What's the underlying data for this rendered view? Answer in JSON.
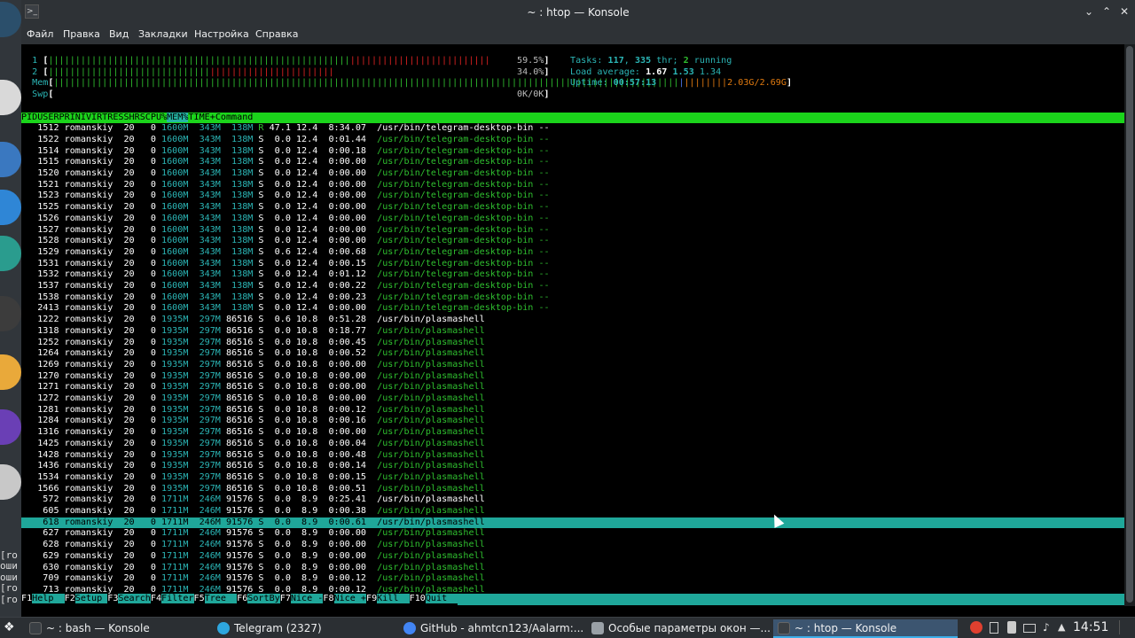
{
  "window": {
    "title": "~ : htop — Konsole"
  },
  "menu": [
    "Файл",
    "Правка",
    "Вид",
    "Закладки",
    "Настройка",
    "Справка"
  ],
  "meters": {
    "cpu1_label": "1",
    "cpu1_green": "||||||||||||||||||||||||||||||||||||||||||||||||||||||||",
    "cpu1_red": "||||||||||||||||||||||||||",
    "cpu1_value": "59.5%",
    "cpu2_label": "2",
    "cpu2_green": "||||||||||||||||||||||||||||||",
    "cpu2_red": "|||||||||||||||||||||||",
    "cpu2_value": "34.0%",
    "mem_label": "Mem",
    "mem_green": "||||||||||||||||||||||||||||||||||||||||||||||||||||||||||||||||||||||||||||||||||||||||||||||||||||||||||||||||||||",
    "mem_blue": "|",
    "mem_yellow": "||||||||",
    "mem_value": "2.03G/2.69G",
    "swp_label": "Swp",
    "swp_value": "0K/0K",
    "tasks_label": "Tasks: ",
    "tasks_count": "117",
    "thr_sep": ", ",
    "thr_count": "335",
    "thr_label": " thr; ",
    "running_count": "2",
    "running_label": " running",
    "load_label": "Load average: ",
    "load1": "1.67",
    "load5": "1.53",
    "load15": "1.34",
    "uptime_label": "Uptime: ",
    "uptime_value": "00:57:13"
  },
  "columns": [
    "PID",
    "USER",
    "PRI",
    "NI",
    "VIRT",
    "RES",
    "SHR",
    "S",
    "CPU%",
    "MEM%",
    "TIME+",
    "Command"
  ],
  "sort_column": "MEM%",
  "processes": [
    {
      "pid": "1512",
      "user": "romanskiy",
      "pri": "20",
      "ni": "0",
      "virt": "1600M",
      "res": "343M",
      "shr": "138M",
      "s": "R",
      "cpu": "47.1",
      "mem": "12.4",
      "time": "8:34.07",
      "cmd": "/usr/bin/telegram-desktop-bin --",
      "thread": false
    },
    {
      "pid": "1522",
      "user": "romanskiy",
      "pri": "20",
      "ni": "0",
      "virt": "1600M",
      "res": "343M",
      "shr": "138M",
      "s": "S",
      "cpu": "0.0",
      "mem": "12.4",
      "time": "0:01.44",
      "cmd": "/usr/bin/telegram-desktop-bin --",
      "thread": true
    },
    {
      "pid": "1514",
      "user": "romanskiy",
      "pri": "20",
      "ni": "0",
      "virt": "1600M",
      "res": "343M",
      "shr": "138M",
      "s": "S",
      "cpu": "0.0",
      "mem": "12.4",
      "time": "0:00.18",
      "cmd": "/usr/bin/telegram-desktop-bin --",
      "thread": true
    },
    {
      "pid": "1515",
      "user": "romanskiy",
      "pri": "20",
      "ni": "0",
      "virt": "1600M",
      "res": "343M",
      "shr": "138M",
      "s": "S",
      "cpu": "0.0",
      "mem": "12.4",
      "time": "0:00.00",
      "cmd": "/usr/bin/telegram-desktop-bin --",
      "thread": true
    },
    {
      "pid": "1520",
      "user": "romanskiy",
      "pri": "20",
      "ni": "0",
      "virt": "1600M",
      "res": "343M",
      "shr": "138M",
      "s": "S",
      "cpu": "0.0",
      "mem": "12.4",
      "time": "0:00.00",
      "cmd": "/usr/bin/telegram-desktop-bin --",
      "thread": true
    },
    {
      "pid": "1521",
      "user": "romanskiy",
      "pri": "20",
      "ni": "0",
      "virt": "1600M",
      "res": "343M",
      "shr": "138M",
      "s": "S",
      "cpu": "0.0",
      "mem": "12.4",
      "time": "0:00.00",
      "cmd": "/usr/bin/telegram-desktop-bin --",
      "thread": true
    },
    {
      "pid": "1523",
      "user": "romanskiy",
      "pri": "20",
      "ni": "0",
      "virt": "1600M",
      "res": "343M",
      "shr": "138M",
      "s": "S",
      "cpu": "0.0",
      "mem": "12.4",
      "time": "0:00.00",
      "cmd": "/usr/bin/telegram-desktop-bin --",
      "thread": true
    },
    {
      "pid": "1525",
      "user": "romanskiy",
      "pri": "20",
      "ni": "0",
      "virt": "1600M",
      "res": "343M",
      "shr": "138M",
      "s": "S",
      "cpu": "0.0",
      "mem": "12.4",
      "time": "0:00.00",
      "cmd": "/usr/bin/telegram-desktop-bin --",
      "thread": true
    },
    {
      "pid": "1526",
      "user": "romanskiy",
      "pri": "20",
      "ni": "0",
      "virt": "1600M",
      "res": "343M",
      "shr": "138M",
      "s": "S",
      "cpu": "0.0",
      "mem": "12.4",
      "time": "0:00.00",
      "cmd": "/usr/bin/telegram-desktop-bin --",
      "thread": true
    },
    {
      "pid": "1527",
      "user": "romanskiy",
      "pri": "20",
      "ni": "0",
      "virt": "1600M",
      "res": "343M",
      "shr": "138M",
      "s": "S",
      "cpu": "0.0",
      "mem": "12.4",
      "time": "0:00.00",
      "cmd": "/usr/bin/telegram-desktop-bin --",
      "thread": true
    },
    {
      "pid": "1528",
      "user": "romanskiy",
      "pri": "20",
      "ni": "0",
      "virt": "1600M",
      "res": "343M",
      "shr": "138M",
      "s": "S",
      "cpu": "0.0",
      "mem": "12.4",
      "time": "0:00.00",
      "cmd": "/usr/bin/telegram-desktop-bin --",
      "thread": true
    },
    {
      "pid": "1529",
      "user": "romanskiy",
      "pri": "20",
      "ni": "0",
      "virt": "1600M",
      "res": "343M",
      "shr": "138M",
      "s": "S",
      "cpu": "0.6",
      "mem": "12.4",
      "time": "0:00.68",
      "cmd": "/usr/bin/telegram-desktop-bin --",
      "thread": true
    },
    {
      "pid": "1531",
      "user": "romanskiy",
      "pri": "20",
      "ni": "0",
      "virt": "1600M",
      "res": "343M",
      "shr": "138M",
      "s": "S",
      "cpu": "0.0",
      "mem": "12.4",
      "time": "0:00.15",
      "cmd": "/usr/bin/telegram-desktop-bin --",
      "thread": true
    },
    {
      "pid": "1532",
      "user": "romanskiy",
      "pri": "20",
      "ni": "0",
      "virt": "1600M",
      "res": "343M",
      "shr": "138M",
      "s": "S",
      "cpu": "0.0",
      "mem": "12.4",
      "time": "0:01.12",
      "cmd": "/usr/bin/telegram-desktop-bin --",
      "thread": true
    },
    {
      "pid": "1537",
      "user": "romanskiy",
      "pri": "20",
      "ni": "0",
      "virt": "1600M",
      "res": "343M",
      "shr": "138M",
      "s": "S",
      "cpu": "0.0",
      "mem": "12.4",
      "time": "0:00.22",
      "cmd": "/usr/bin/telegram-desktop-bin --",
      "thread": true
    },
    {
      "pid": "1538",
      "user": "romanskiy",
      "pri": "20",
      "ni": "0",
      "virt": "1600M",
      "res": "343M",
      "shr": "138M",
      "s": "S",
      "cpu": "0.0",
      "mem": "12.4",
      "time": "0:00.23",
      "cmd": "/usr/bin/telegram-desktop-bin --",
      "thread": true
    },
    {
      "pid": "2413",
      "user": "romanskiy",
      "pri": "20",
      "ni": "0",
      "virt": "1600M",
      "res": "343M",
      "shr": "138M",
      "s": "S",
      "cpu": "0.0",
      "mem": "12.4",
      "time": "0:00.00",
      "cmd": "/usr/bin/telegram-desktop-bin --",
      "thread": true
    },
    {
      "pid": "1222",
      "user": "romanskiy",
      "pri": "20",
      "ni": "0",
      "virt": "1935M",
      "res": "297M",
      "shr": "86516",
      "s": "S",
      "cpu": "0.6",
      "mem": "10.8",
      "time": "0:51.28",
      "cmd": "/usr/bin/plasmashell",
      "thread": false
    },
    {
      "pid": "1318",
      "user": "romanskiy",
      "pri": "20",
      "ni": "0",
      "virt": "1935M",
      "res": "297M",
      "shr": "86516",
      "s": "S",
      "cpu": "0.0",
      "mem": "10.8",
      "time": "0:18.77",
      "cmd": "/usr/bin/plasmashell",
      "thread": true
    },
    {
      "pid": "1252",
      "user": "romanskiy",
      "pri": "20",
      "ni": "0",
      "virt": "1935M",
      "res": "297M",
      "shr": "86516",
      "s": "S",
      "cpu": "0.0",
      "mem": "10.8",
      "time": "0:00.45",
      "cmd": "/usr/bin/plasmashell",
      "thread": true
    },
    {
      "pid": "1264",
      "user": "romanskiy",
      "pri": "20",
      "ni": "0",
      "virt": "1935M",
      "res": "297M",
      "shr": "86516",
      "s": "S",
      "cpu": "0.0",
      "mem": "10.8",
      "time": "0:00.52",
      "cmd": "/usr/bin/plasmashell",
      "thread": true
    },
    {
      "pid": "1269",
      "user": "romanskiy",
      "pri": "20",
      "ni": "0",
      "virt": "1935M",
      "res": "297M",
      "shr": "86516",
      "s": "S",
      "cpu": "0.0",
      "mem": "10.8",
      "time": "0:00.00",
      "cmd": "/usr/bin/plasmashell",
      "thread": true
    },
    {
      "pid": "1270",
      "user": "romanskiy",
      "pri": "20",
      "ni": "0",
      "virt": "1935M",
      "res": "297M",
      "shr": "86516",
      "s": "S",
      "cpu": "0.0",
      "mem": "10.8",
      "time": "0:00.00",
      "cmd": "/usr/bin/plasmashell",
      "thread": true
    },
    {
      "pid": "1271",
      "user": "romanskiy",
      "pri": "20",
      "ni": "0",
      "virt": "1935M",
      "res": "297M",
      "shr": "86516",
      "s": "S",
      "cpu": "0.0",
      "mem": "10.8",
      "time": "0:00.00",
      "cmd": "/usr/bin/plasmashell",
      "thread": true
    },
    {
      "pid": "1272",
      "user": "romanskiy",
      "pri": "20",
      "ni": "0",
      "virt": "1935M",
      "res": "297M",
      "shr": "86516",
      "s": "S",
      "cpu": "0.0",
      "mem": "10.8",
      "time": "0:00.00",
      "cmd": "/usr/bin/plasmashell",
      "thread": true
    },
    {
      "pid": "1281",
      "user": "romanskiy",
      "pri": "20",
      "ni": "0",
      "virt": "1935M",
      "res": "297M",
      "shr": "86516",
      "s": "S",
      "cpu": "0.0",
      "mem": "10.8",
      "time": "0:00.12",
      "cmd": "/usr/bin/plasmashell",
      "thread": true
    },
    {
      "pid": "1284",
      "user": "romanskiy",
      "pri": "20",
      "ni": "0",
      "virt": "1935M",
      "res": "297M",
      "shr": "86516",
      "s": "S",
      "cpu": "0.0",
      "mem": "10.8",
      "time": "0:00.16",
      "cmd": "/usr/bin/plasmashell",
      "thread": true
    },
    {
      "pid": "1316",
      "user": "romanskiy",
      "pri": "20",
      "ni": "0",
      "virt": "1935M",
      "res": "297M",
      "shr": "86516",
      "s": "S",
      "cpu": "0.0",
      "mem": "10.8",
      "time": "0:00.00",
      "cmd": "/usr/bin/plasmashell",
      "thread": true
    },
    {
      "pid": "1425",
      "user": "romanskiy",
      "pri": "20",
      "ni": "0",
      "virt": "1935M",
      "res": "297M",
      "shr": "86516",
      "s": "S",
      "cpu": "0.0",
      "mem": "10.8",
      "time": "0:00.04",
      "cmd": "/usr/bin/plasmashell",
      "thread": true
    },
    {
      "pid": "1428",
      "user": "romanskiy",
      "pri": "20",
      "ni": "0",
      "virt": "1935M",
      "res": "297M",
      "shr": "86516",
      "s": "S",
      "cpu": "0.0",
      "mem": "10.8",
      "time": "0:00.48",
      "cmd": "/usr/bin/plasmashell",
      "thread": true
    },
    {
      "pid": "1436",
      "user": "romanskiy",
      "pri": "20",
      "ni": "0",
      "virt": "1935M",
      "res": "297M",
      "shr": "86516",
      "s": "S",
      "cpu": "0.0",
      "mem": "10.8",
      "time": "0:00.14",
      "cmd": "/usr/bin/plasmashell",
      "thread": true
    },
    {
      "pid": "1534",
      "user": "romanskiy",
      "pri": "20",
      "ni": "0",
      "virt": "1935M",
      "res": "297M",
      "shr": "86516",
      "s": "S",
      "cpu": "0.0",
      "mem": "10.8",
      "time": "0:00.15",
      "cmd": "/usr/bin/plasmashell",
      "thread": true
    },
    {
      "pid": "1566",
      "user": "romanskiy",
      "pri": "20",
      "ni": "0",
      "virt": "1935M",
      "res": "297M",
      "shr": "86516",
      "s": "S",
      "cpu": "0.0",
      "mem": "10.8",
      "time": "0:00.51",
      "cmd": "/usr/bin/plasmashell",
      "thread": true
    },
    {
      "pid": "572",
      "user": "romanskiy",
      "pri": "20",
      "ni": "0",
      "virt": "1711M",
      "res": "246M",
      "shr": "91576",
      "s": "S",
      "cpu": "0.0",
      "mem": "8.9",
      "time": "0:25.41",
      "cmd": "/usr/bin/plasmashell",
      "thread": false
    },
    {
      "pid": "605",
      "user": "romanskiy",
      "pri": "20",
      "ni": "0",
      "virt": "1711M",
      "res": "246M",
      "shr": "91576",
      "s": "S",
      "cpu": "0.0",
      "mem": "8.9",
      "time": "0:00.38",
      "cmd": "/usr/bin/plasmashell",
      "thread": true
    },
    {
      "pid": "618",
      "user": "romanskiy",
      "pri": "20",
      "ni": "0",
      "virt": "1711M",
      "res": "246M",
      "shr": "91576",
      "s": "S",
      "cpu": "0.0",
      "mem": "8.9",
      "time": "0:00.61",
      "cmd": "/usr/bin/plasmashell",
      "thread": true,
      "selected": true
    },
    {
      "pid": "627",
      "user": "romanskiy",
      "pri": "20",
      "ni": "0",
      "virt": "1711M",
      "res": "246M",
      "shr": "91576",
      "s": "S",
      "cpu": "0.0",
      "mem": "8.9",
      "time": "0:00.00",
      "cmd": "/usr/bin/plasmashell",
      "thread": true
    },
    {
      "pid": "628",
      "user": "romanskiy",
      "pri": "20",
      "ni": "0",
      "virt": "1711M",
      "res": "246M",
      "shr": "91576",
      "s": "S",
      "cpu": "0.0",
      "mem": "8.9",
      "time": "0:00.00",
      "cmd": "/usr/bin/plasmashell",
      "thread": true
    },
    {
      "pid": "629",
      "user": "romanskiy",
      "pri": "20",
      "ni": "0",
      "virt": "1711M",
      "res": "246M",
      "shr": "91576",
      "s": "S",
      "cpu": "0.0",
      "mem": "8.9",
      "time": "0:00.00",
      "cmd": "/usr/bin/plasmashell",
      "thread": true
    },
    {
      "pid": "630",
      "user": "romanskiy",
      "pri": "20",
      "ni": "0",
      "virt": "1711M",
      "res": "246M",
      "shr": "91576",
      "s": "S",
      "cpu": "0.0",
      "mem": "8.9",
      "time": "0:00.00",
      "cmd": "/usr/bin/plasmashell",
      "thread": true
    },
    {
      "pid": "709",
      "user": "romanskiy",
      "pri": "20",
      "ni": "0",
      "virt": "1711M",
      "res": "246M",
      "shr": "91576",
      "s": "S",
      "cpu": "0.0",
      "mem": "8.9",
      "time": "0:00.12",
      "cmd": "/usr/bin/plasmashell",
      "thread": true
    },
    {
      "pid": "713",
      "user": "romanskiy",
      "pri": "20",
      "ni": "0",
      "virt": "1711M",
      "res": "246M",
      "shr": "91576",
      "s": "S",
      "cpu": "0.0",
      "mem": "8.9",
      "time": "0:00.12",
      "cmd": "/usr/bin/plasmashell",
      "thread": true
    }
  ],
  "fkeys": [
    {
      "key": "F1",
      "label": "Help  "
    },
    {
      "key": "F2",
      "label": "Setup "
    },
    {
      "key": "F3",
      "label": "Search"
    },
    {
      "key": "F4",
      "label": "Filter"
    },
    {
      "key": "F5",
      "label": "Tree  "
    },
    {
      "key": "F6",
      "label": "SortBy"
    },
    {
      "key": "F7",
      "label": "Nice -"
    },
    {
      "key": "F8",
      "label": "Nice +"
    },
    {
      "key": "F9",
      "label": "Kill  "
    },
    {
      "key": "F10",
      "label": "Quit  "
    }
  ],
  "dock_text": [
    "[ro",
    "оши",
    "оши",
    "[ro",
    "[ro"
  ],
  "taskbar": {
    "tasks": [
      {
        "label": "~ : bash — Konsole",
        "icon": "terminal-icon",
        "active": false
      },
      {
        "label": "Telegram (2327)",
        "icon": "telegram-icon",
        "active": false
      },
      {
        "label": "GitHub - ahmtcn123/Aalarm:...",
        "icon": "chrome-icon",
        "active": false
      },
      {
        "label": "Особые параметры окон —...",
        "icon": "window-icon",
        "active": false
      },
      {
        "label": "~ : htop — Konsole",
        "icon": "terminal-icon",
        "active": true
      }
    ],
    "clock": "14:51"
  },
  "colors": {
    "accent": "#3daee9",
    "header_green": "#1bd41b",
    "selection_teal": "#1fa79a"
  }
}
